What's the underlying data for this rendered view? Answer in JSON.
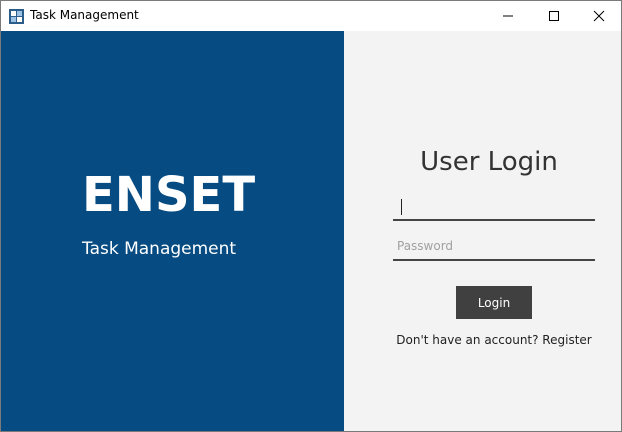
{
  "window": {
    "title": "Task Management",
    "controls": {
      "minimize": "minimize-icon",
      "maximize": "maximize-icon",
      "close": "close-icon"
    }
  },
  "left_panel": {
    "brand": "ENSET",
    "subtitle": "Task Management",
    "background": "#064c82"
  },
  "login": {
    "title": "User Login",
    "username": {
      "value": "",
      "placeholder": ""
    },
    "password": {
      "value": "",
      "placeholder": "Password"
    },
    "button_label": "Login",
    "register_text": "Don't have an account? Register"
  }
}
